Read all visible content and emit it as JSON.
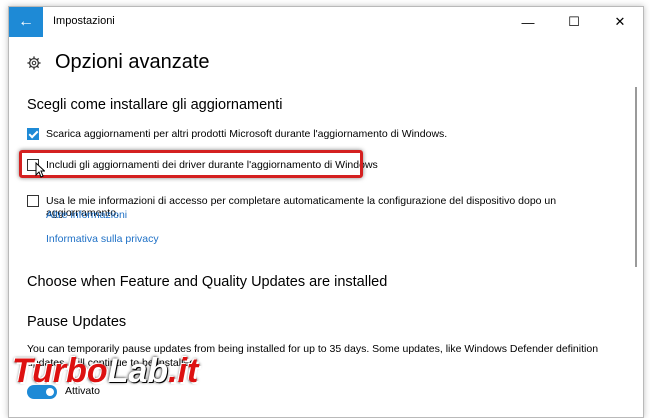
{
  "window": {
    "title": "Impostazioni",
    "back_glyph": "←",
    "min_glyph": "—",
    "max_glyph": "☐",
    "close_glyph": "✕"
  },
  "header": {
    "title": "Opzioni avanzate",
    "icon": "gear-icon"
  },
  "section_install": {
    "title": "Scegli come installare gli aggiornamenti"
  },
  "options": [
    {
      "label": "Scarica aggiornamenti per altri prodotti Microsoft durante l'aggiornamento di Windows.",
      "checked": true
    },
    {
      "label": "Includi gli aggiornamenti dei driver durante l'aggiornamento di Windows",
      "checked": false
    },
    {
      "label": "Usa le mie informazioni di accesso per completare automaticamente la configurazione del dispositivo dopo un aggiornamento.",
      "checked": false
    }
  ],
  "links": {
    "more_info": "Altre informazioni",
    "privacy": "Informativa sulla privacy"
  },
  "section_feature": {
    "title": "Choose when Feature and Quality Updates are installed"
  },
  "section_pause": {
    "title": "Pause Updates",
    "description": "You can temporarily pause updates from being installed for up to 35 days. Some updates, like Windows Defender definition updates, will continue to be installed.",
    "toggle_label": "Attivato",
    "toggle_on": true
  },
  "watermark": {
    "part1": "Turbo",
    "part2": "Lab",
    "part3": ".it"
  },
  "colors": {
    "accent": "#1e8ad6",
    "highlight": "#d42020",
    "link": "#1e70c6"
  }
}
